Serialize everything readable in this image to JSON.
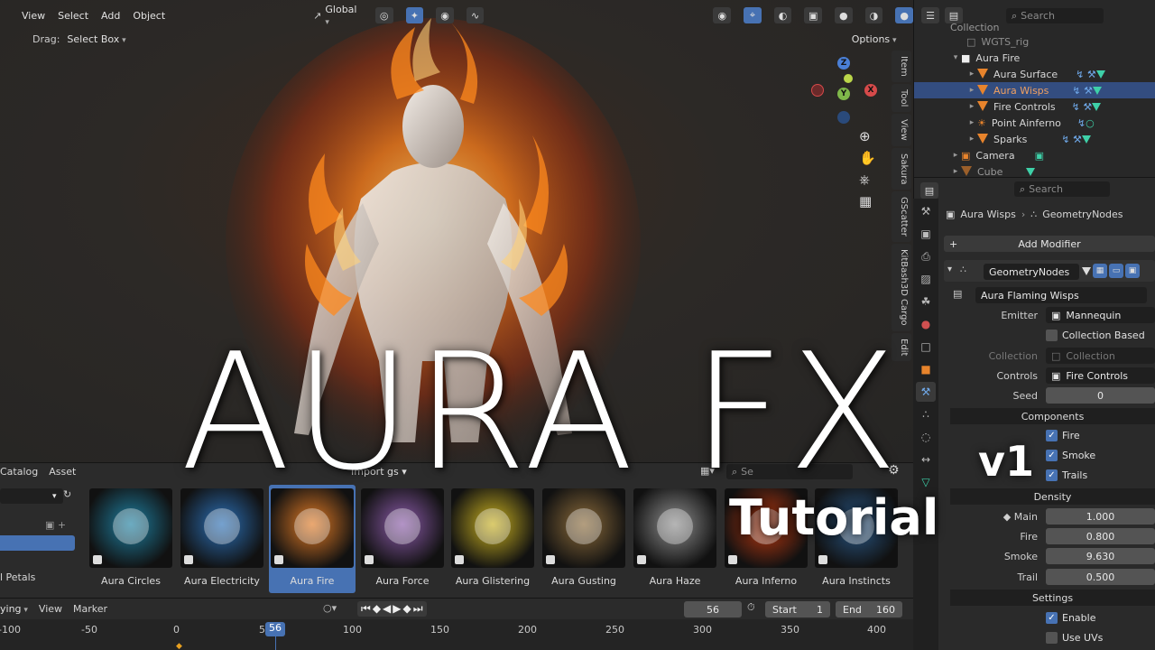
{
  "viewport": {
    "menu": [
      "View",
      "Select",
      "Add",
      "Object"
    ],
    "orientation": "Global",
    "drag_label": "Drag:",
    "drag_mode": "Select Box",
    "options": "Options",
    "side_tabs": [
      "Item",
      "Tool",
      "View",
      "Sakura",
      "GScatter",
      "KitBash3D Cargo",
      "Edit"
    ],
    "gizmo": {
      "z": "Z",
      "y": "Y",
      "x": "X"
    }
  },
  "outliner": {
    "search_placeholder": "Search",
    "items": [
      {
        "label": "Collection",
        "indent": 0
      },
      {
        "label": "WGTS_rig",
        "indent": 1
      },
      {
        "label": "Aura Fire",
        "indent": 0
      },
      {
        "label": "Aura Surface",
        "indent": 1
      },
      {
        "label": "Aura Wisps",
        "indent": 1
      },
      {
        "label": "Fire Controls",
        "indent": 1
      },
      {
        "label": "Point Ainferno",
        "indent": 1
      },
      {
        "label": "Sparks",
        "indent": 1
      },
      {
        "label": "Camera",
        "indent": 0
      },
      {
        "label": "Cube",
        "indent": 0
      }
    ]
  },
  "properties": {
    "search_placeholder": "Search",
    "breadcrumb_object": "Aura Wisps",
    "breadcrumb_modifier": "GeometryNodes",
    "add_modifier": "Add Modifier",
    "modifier_name": "GeometryNodes",
    "node_group": "Aura Flaming Wisps",
    "fields": {
      "emitter_label": "Emitter",
      "emitter_value": "Mannequin",
      "collection_based": "Collection Based",
      "collection_label": "Collection",
      "collection_value": "Collection",
      "controls_label": "Controls",
      "controls_value": "Fire Controls",
      "seed_label": "Seed",
      "seed_value": "0"
    },
    "components_header": "Components",
    "components": [
      "Fire",
      "Smoke",
      "Trails"
    ],
    "density_header": "Density",
    "density": [
      {
        "label": "Main",
        "value": "1.000"
      },
      {
        "label": "Fire",
        "value": "0.800"
      },
      {
        "label": "Smoke",
        "value": "9.630"
      },
      {
        "label": "Trail",
        "value": "0.500"
      }
    ],
    "settings_header": "Settings",
    "settings": [
      "Enable",
      "Use UVs"
    ]
  },
  "asset_browser": {
    "tabs": [
      "Catalog",
      "Asset"
    ],
    "import_label": "Import",
    "import_mode": "gs",
    "search_placeholder": "Se",
    "left_item": "l Petals",
    "assets": [
      {
        "label": "Aura Circles",
        "color": "#1e7fa0"
      },
      {
        "label": "Aura Electricity",
        "color": "#2b6fb5"
      },
      {
        "label": "Aura Fire",
        "color": "#e07a25"
      },
      {
        "label": "Aura Force",
        "color": "#8a5aa8"
      },
      {
        "label": "Aura Glistering",
        "color": "#c8b020"
      },
      {
        "label": "Aura Gusting",
        "color": "#8a6a3a"
      },
      {
        "label": "Aura Haze",
        "color": "#8e8e8e"
      },
      {
        "label": "Aura Inferno",
        "color": "#c23a10"
      },
      {
        "label": "Aura Instincts",
        "color": "#2a5a8a"
      }
    ],
    "selected": 2
  },
  "timeline": {
    "menu": [
      "ying",
      "View",
      "Marker"
    ],
    "current_frame": "56",
    "start_label": "Start",
    "start": "1",
    "end_label": "End",
    "end": "160",
    "ticks": [
      "-100",
      "-50",
      "0",
      "5",
      "100",
      "150",
      "200",
      "250",
      "300",
      "350",
      "400"
    ],
    "playhead": "56"
  },
  "overlay": {
    "title": "AURA FX",
    "version": "v1",
    "subtitle": "Tutorial"
  }
}
